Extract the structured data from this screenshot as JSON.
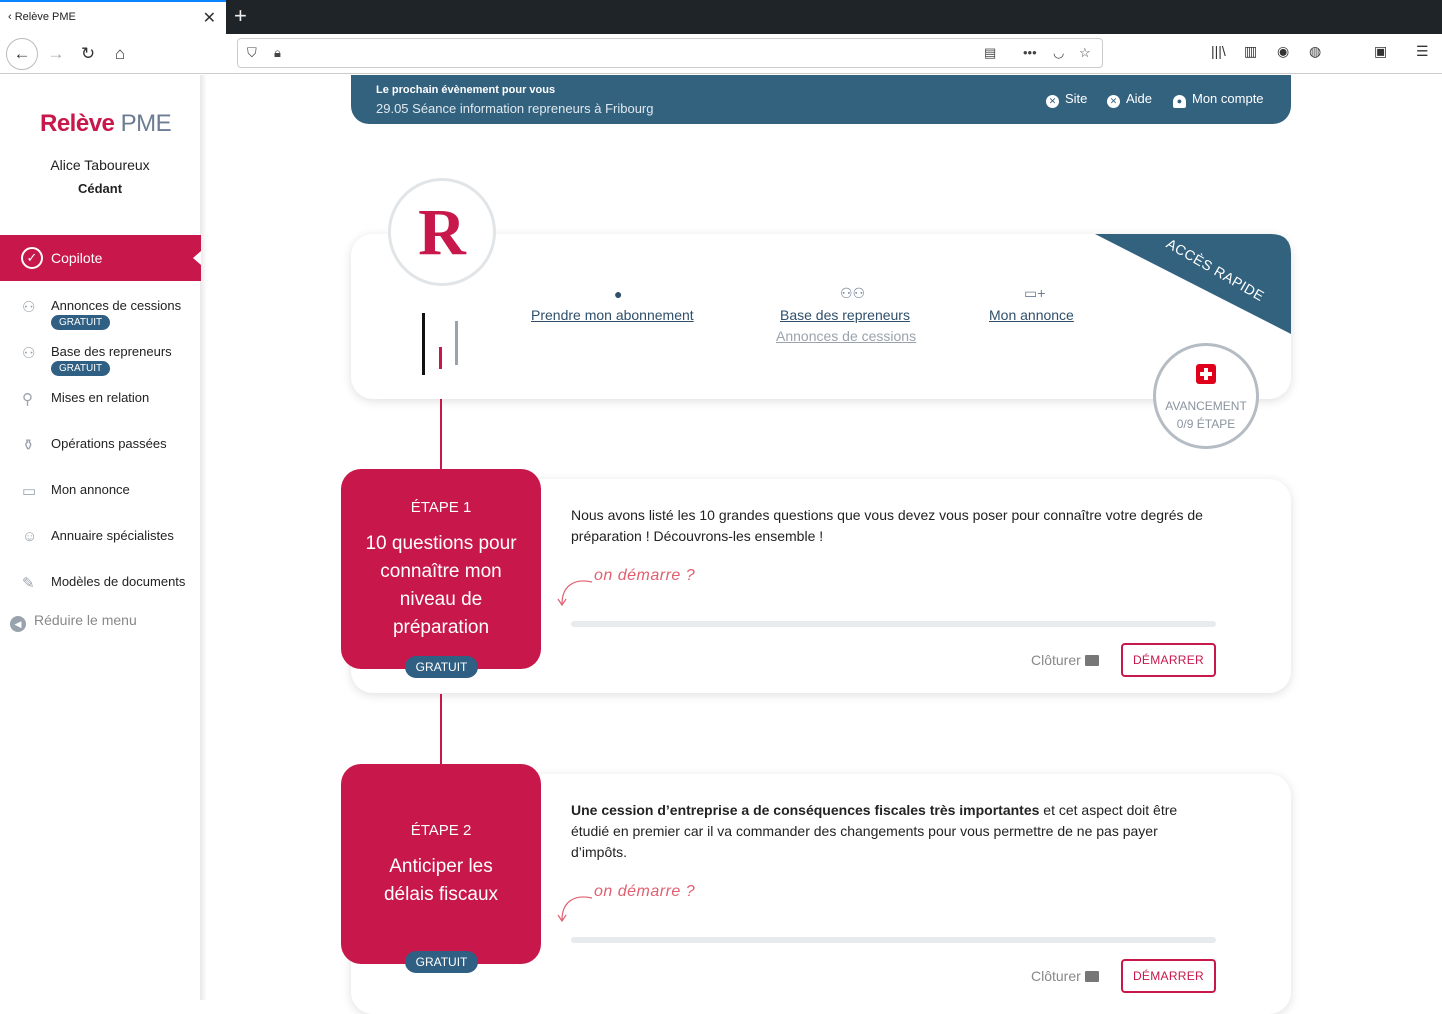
{
  "browser": {
    "tab_title": "‹ Relève PME",
    "tab_close": "✕",
    "new_tab": "+"
  },
  "sidebar": {
    "logo_brand": "Relève",
    "logo_suffix": "PME",
    "user_name": "Alice Taboureux",
    "user_role": "Cédant",
    "active_item": "Copilote",
    "items": [
      {
        "label": "Annonces de cessions",
        "badge": "GRATUIT",
        "icon": "handshake-icon"
      },
      {
        "label": "Base des repreneurs",
        "badge": "GRATUIT",
        "icon": "users-icon"
      },
      {
        "label": "Mises en relation",
        "badge": "",
        "icon": "connect-icon"
      },
      {
        "label": "Opérations passées",
        "badge": "",
        "icon": "jar-icon"
      },
      {
        "label": "Mon annonce",
        "badge": "",
        "icon": "ad-icon"
      },
      {
        "label": "Annuaire spécialistes",
        "badge": "",
        "icon": "specialist-icon"
      },
      {
        "label": "Modèles de documents",
        "badge": "",
        "icon": "document-icon"
      }
    ],
    "reduce_label": "Réduire le menu"
  },
  "banner": {
    "next_event_label": "Le prochain évènement pour vous",
    "next_event": "29.05 Séance information repreneurs à Fribourg",
    "links": {
      "site": "Site",
      "help": "Aide",
      "account": "Mon compte"
    }
  },
  "quick_access": {
    "avatar_letter": "R",
    "ribbon": "ACCÈS RAPIDE",
    "links": {
      "subscribe": "Prendre mon abonnement",
      "buyers": "Base des repreneurs",
      "listings": "Annonces de cessions",
      "my_ad": "Mon annonce"
    },
    "progress_label": "AVANCEMENT",
    "progress_value": "0/9 ÉTAPE"
  },
  "steps": [
    {
      "num": "ÉTAPE 1",
      "title": "10 questions pour connaître mon niveau de préparation",
      "badge": "GRATUIT",
      "text_bold": "",
      "text": "Nous avons listé les 10 grandes questions que vous devez vous poser pour connaître votre degrés de préparation ! Découvrons-les ensemble !",
      "hint": "on démarre ?",
      "progress": 0,
      "close_label": "Clôturer",
      "start_label": "DÉMARRER"
    },
    {
      "num": "ÉTAPE 2",
      "title": "Anticiper les délais fiscaux",
      "badge": "GRATUIT",
      "text_bold": "Une cession d’entreprise a de conséquences fiscales très importantes",
      "text": " et cet aspect doit être étudié en premier car il va commander des changements pour vous permettre de ne pas payer d’impôts.",
      "hint": "on démarre ?",
      "progress": 0,
      "close_label": "Clôturer",
      "start_label": "DÉMARRER"
    }
  ],
  "colors": {
    "brand_red": "#c8174a",
    "brand_blue": "#33627f",
    "badge_blue": "#2f5f82"
  }
}
